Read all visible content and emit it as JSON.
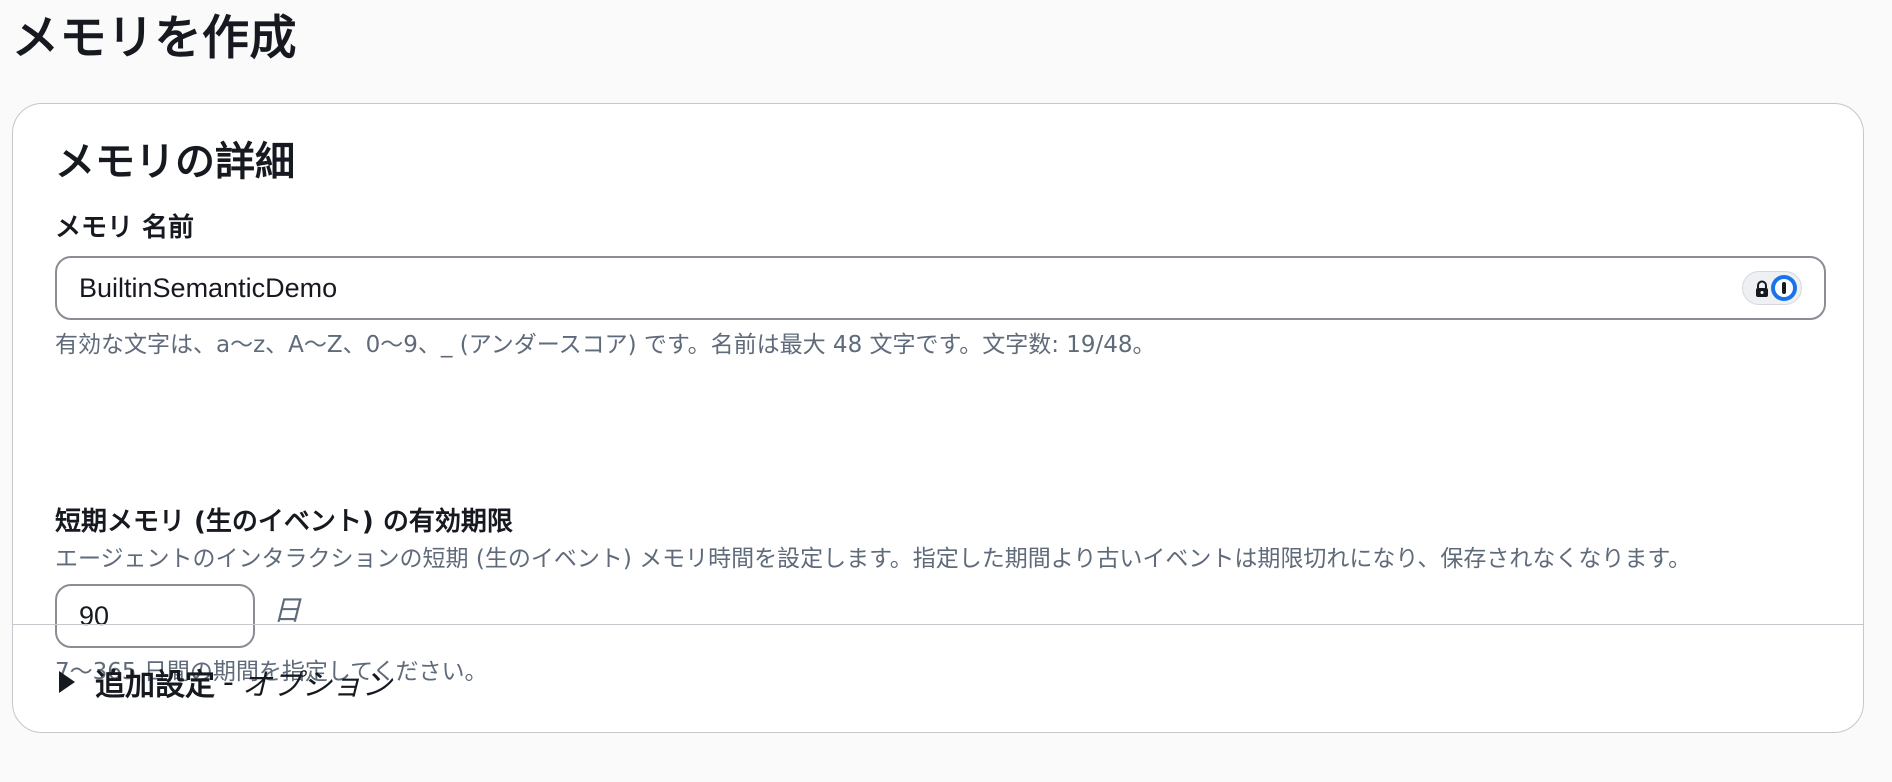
{
  "page": {
    "title": "メモリを作成"
  },
  "memory_details": {
    "section_title": "メモリの詳細",
    "name_field": {
      "label": "メモリ 名前",
      "value": "BuiltinSemanticDemo",
      "hint": "有効な文字は、a〜z、A〜Z、0〜9、_ (アンダースコア) です。名前は最大 48 文字です。文字数: 19/48。"
    },
    "password_manager_icons": [
      "lock-icon",
      "key-icon"
    ],
    "retention_field": {
      "label": "短期メモリ (生のイベント) の有効期限",
      "description": "エージェントのインタラクションの短期 (生のイベント) メモリ時間を設定します。指定した期間より古いイベントは期限切れになり、保存されなくなります。",
      "value": "90",
      "unit": "日",
      "hint": "7〜365 日間の期間を指定してください。"
    }
  },
  "additional_settings": {
    "title": "追加設定",
    "separator": "-",
    "optional": "オプション",
    "expanded": false
  }
}
